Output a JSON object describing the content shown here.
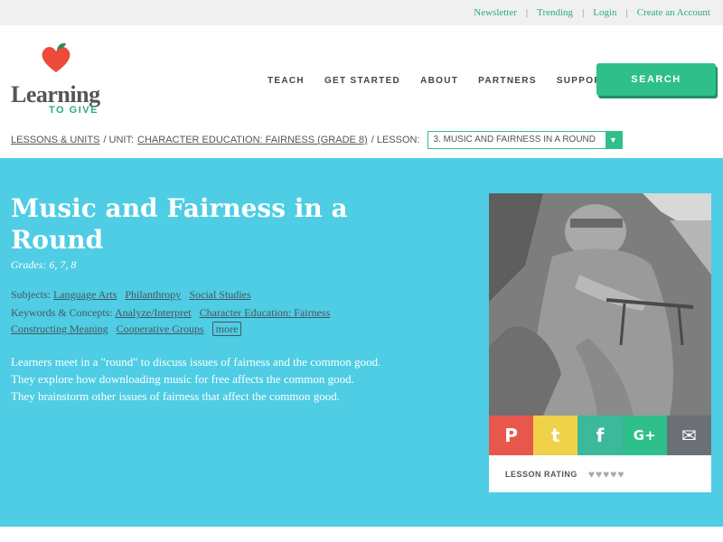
{
  "util_links": [
    "Newsletter",
    "Trending",
    "Login",
    "Create an Account"
  ],
  "logo": {
    "word": "Learning",
    "sub": "TO GIVE"
  },
  "nav": [
    "TEACH",
    "GET STARTED",
    "ABOUT",
    "PARTNERS",
    "SUPPORT US"
  ],
  "search_label": "SEARCH",
  "breadcrumb": {
    "lessons_units": "LESSONS & UNITS",
    "unit_prefix": "/ UNIT:",
    "unit": "CHARACTER EDUCATION: FAIRNESS (GRADE 8)",
    "lesson_prefix": "/ LESSON:",
    "lesson_selected": "3. MUSIC AND FAIRNESS IN A ROUND"
  },
  "lesson": {
    "title": "Music and Fairness in a Round",
    "grades": "Grades: 6, 7, 8",
    "subjects_label": "Subjects:",
    "subjects": [
      "Language Arts",
      "Philanthropy",
      "Social Studies"
    ],
    "keywords_label": "Keywords & Concepts:",
    "keywords": [
      "Analyze/Interpret",
      "Character Education: Fairness",
      "Constructing Meaning",
      "Cooperative Groups"
    ],
    "more_label": "more",
    "description": [
      "Learners meet in a \"round\" to discuss issues of fairness and the common good.",
      "They explore how downloading music for free affects the common good.",
      "They brainstorm other issues of fairness that affect the common good."
    ]
  },
  "share": {
    "pinterest": "P",
    "twitter": "t",
    "facebook": "f",
    "googleplus": "G+",
    "email": "✉"
  },
  "rating": {
    "label": "LESSON RATING",
    "value": 0,
    "max": 5
  },
  "colors": {
    "accent": "#2fbf8a",
    "hero": "#4ecde4",
    "link": "#2aaa86"
  }
}
